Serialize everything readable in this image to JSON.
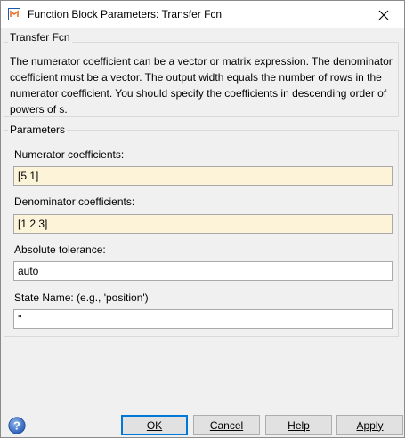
{
  "window": {
    "title": "Function Block Parameters: Transfer Fcn"
  },
  "description": {
    "group_title": "Transfer Fcn",
    "text": "The numerator coefficient can be a vector or matrix expression. The denominator coefficient must be a vector. The output width equals the number of rows in the numerator coefficient. You should specify the coefficients in descending order of powers of s."
  },
  "parameters": {
    "group_title": "Parameters",
    "fields": [
      {
        "label": "Numerator coefficients:",
        "value": "[5 1]"
      },
      {
        "label": "Denominator coefficients:",
        "value": "[1 2 3]"
      },
      {
        "label": "Absolute tolerance:",
        "value": "auto"
      },
      {
        "label": "State Name: (e.g., 'position')",
        "value": "''"
      }
    ]
  },
  "buttons": {
    "ok": "OK",
    "cancel": "Cancel",
    "help": "Help",
    "apply": "Apply"
  },
  "colors": {
    "editable_field_bg": "#fcf3d9",
    "default_button_border": "#0078d7"
  },
  "icons": {
    "title": "simulink-block-icon",
    "close": "close-icon",
    "help": "help-question-icon"
  }
}
